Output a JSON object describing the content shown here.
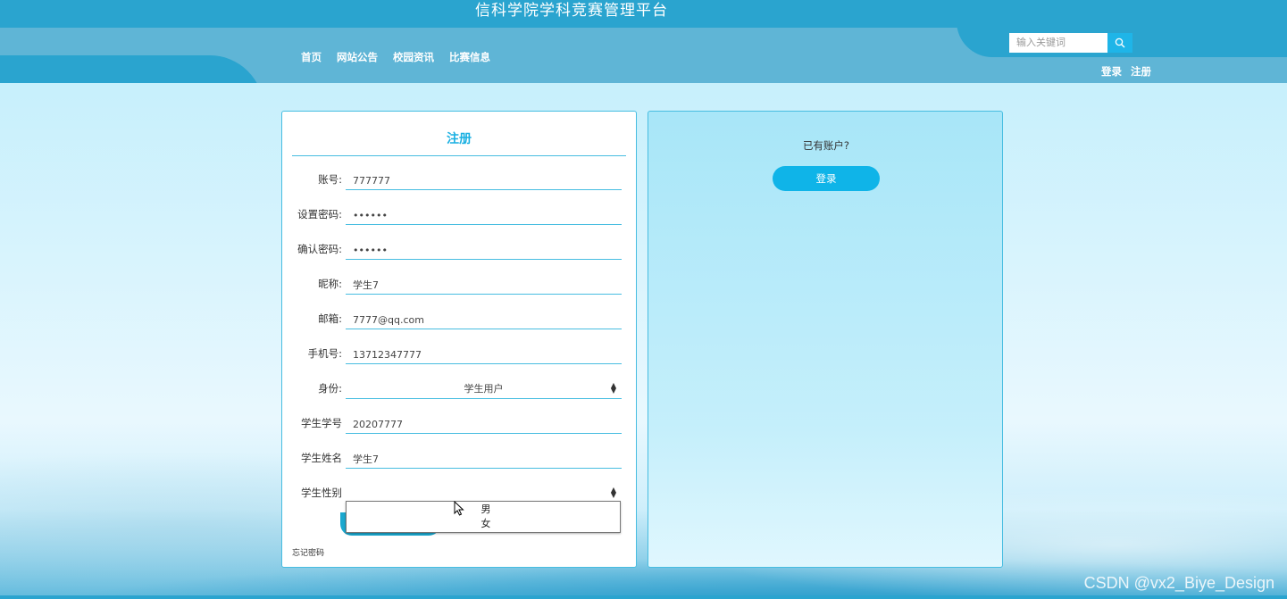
{
  "header": {
    "site_title": "信科学院学科竞赛管理平台",
    "nav": [
      "首页",
      "网站公告",
      "校园资讯",
      "比赛信息"
    ],
    "search_placeholder": "输入关键词",
    "auth": {
      "login": "登录",
      "register": "注册"
    }
  },
  "register": {
    "title": "注册",
    "fields": [
      {
        "label": "账号:",
        "value": "777777"
      },
      {
        "label": "设置密码:",
        "value": "••••••"
      },
      {
        "label": "确认密码:",
        "value": "••••••"
      },
      {
        "label": "昵称:",
        "value": "学生7"
      },
      {
        "label": "邮箱:",
        "value": "7777@qq.com"
      },
      {
        "label": "手机号:",
        "value": "13712347777"
      },
      {
        "label": "身份:",
        "value": "学生用户"
      },
      {
        "label": "学生学号",
        "value": "20207777"
      },
      {
        "label": "学生姓名",
        "value": "学生7"
      },
      {
        "label": "学生性别",
        "value": ""
      }
    ],
    "gender_options": [
      "男",
      "女"
    ],
    "forgot_password": "忘记密码"
  },
  "login_panel": {
    "prompt": "已有账户?",
    "login_button": "登录"
  },
  "watermark": "CSDN @vx2_Biye_Design",
  "colors": {
    "accent": "#1ab0e2",
    "header": "#2aa4cf",
    "header_light": "#5fb5d6"
  }
}
